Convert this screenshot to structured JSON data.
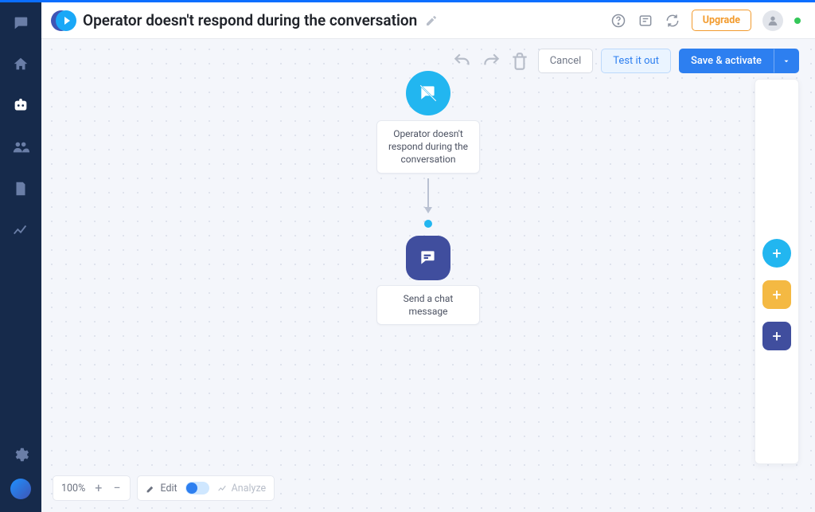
{
  "page_title": "Operator doesn't respond during the conversation",
  "header": {
    "upgrade_label": "Upgrade"
  },
  "toolbar": {
    "cancel_label": "Cancel",
    "test_label": "Test it out",
    "save_label": "Save & activate"
  },
  "flow": {
    "trigger": {
      "label": "Operator doesn't respond during the conversation"
    },
    "action": {
      "label": "Send a chat message"
    }
  },
  "zoom": {
    "value": "100%",
    "edit_label": "Edit",
    "analyze_label": "Analyze"
  },
  "palette": {
    "add_trigger": "+",
    "add_condition": "+",
    "add_action": "+"
  }
}
